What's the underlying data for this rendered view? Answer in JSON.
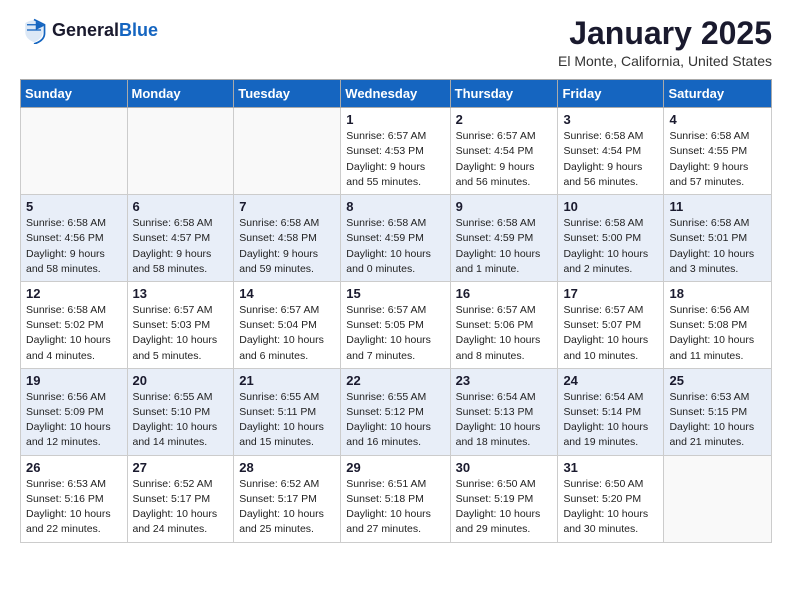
{
  "header": {
    "logo_general": "General",
    "logo_blue": "Blue",
    "month": "January 2025",
    "location": "El Monte, California, United States"
  },
  "weekdays": [
    "Sunday",
    "Monday",
    "Tuesday",
    "Wednesday",
    "Thursday",
    "Friday",
    "Saturday"
  ],
  "weeks": [
    [
      {
        "num": "",
        "detail": ""
      },
      {
        "num": "",
        "detail": ""
      },
      {
        "num": "",
        "detail": ""
      },
      {
        "num": "1",
        "detail": "Sunrise: 6:57 AM\nSunset: 4:53 PM\nDaylight: 9 hours\nand 55 minutes."
      },
      {
        "num": "2",
        "detail": "Sunrise: 6:57 AM\nSunset: 4:54 PM\nDaylight: 9 hours\nand 56 minutes."
      },
      {
        "num": "3",
        "detail": "Sunrise: 6:58 AM\nSunset: 4:54 PM\nDaylight: 9 hours\nand 56 minutes."
      },
      {
        "num": "4",
        "detail": "Sunrise: 6:58 AM\nSunset: 4:55 PM\nDaylight: 9 hours\nand 57 minutes."
      }
    ],
    [
      {
        "num": "5",
        "detail": "Sunrise: 6:58 AM\nSunset: 4:56 PM\nDaylight: 9 hours\nand 58 minutes."
      },
      {
        "num": "6",
        "detail": "Sunrise: 6:58 AM\nSunset: 4:57 PM\nDaylight: 9 hours\nand 58 minutes."
      },
      {
        "num": "7",
        "detail": "Sunrise: 6:58 AM\nSunset: 4:58 PM\nDaylight: 9 hours\nand 59 minutes."
      },
      {
        "num": "8",
        "detail": "Sunrise: 6:58 AM\nSunset: 4:59 PM\nDaylight: 10 hours\nand 0 minutes."
      },
      {
        "num": "9",
        "detail": "Sunrise: 6:58 AM\nSunset: 4:59 PM\nDaylight: 10 hours\nand 1 minute."
      },
      {
        "num": "10",
        "detail": "Sunrise: 6:58 AM\nSunset: 5:00 PM\nDaylight: 10 hours\nand 2 minutes."
      },
      {
        "num": "11",
        "detail": "Sunrise: 6:58 AM\nSunset: 5:01 PM\nDaylight: 10 hours\nand 3 minutes."
      }
    ],
    [
      {
        "num": "12",
        "detail": "Sunrise: 6:58 AM\nSunset: 5:02 PM\nDaylight: 10 hours\nand 4 minutes."
      },
      {
        "num": "13",
        "detail": "Sunrise: 6:57 AM\nSunset: 5:03 PM\nDaylight: 10 hours\nand 5 minutes."
      },
      {
        "num": "14",
        "detail": "Sunrise: 6:57 AM\nSunset: 5:04 PM\nDaylight: 10 hours\nand 6 minutes."
      },
      {
        "num": "15",
        "detail": "Sunrise: 6:57 AM\nSunset: 5:05 PM\nDaylight: 10 hours\nand 7 minutes."
      },
      {
        "num": "16",
        "detail": "Sunrise: 6:57 AM\nSunset: 5:06 PM\nDaylight: 10 hours\nand 8 minutes."
      },
      {
        "num": "17",
        "detail": "Sunrise: 6:57 AM\nSunset: 5:07 PM\nDaylight: 10 hours\nand 10 minutes."
      },
      {
        "num": "18",
        "detail": "Sunrise: 6:56 AM\nSunset: 5:08 PM\nDaylight: 10 hours\nand 11 minutes."
      }
    ],
    [
      {
        "num": "19",
        "detail": "Sunrise: 6:56 AM\nSunset: 5:09 PM\nDaylight: 10 hours\nand 12 minutes."
      },
      {
        "num": "20",
        "detail": "Sunrise: 6:55 AM\nSunset: 5:10 PM\nDaylight: 10 hours\nand 14 minutes."
      },
      {
        "num": "21",
        "detail": "Sunrise: 6:55 AM\nSunset: 5:11 PM\nDaylight: 10 hours\nand 15 minutes."
      },
      {
        "num": "22",
        "detail": "Sunrise: 6:55 AM\nSunset: 5:12 PM\nDaylight: 10 hours\nand 16 minutes."
      },
      {
        "num": "23",
        "detail": "Sunrise: 6:54 AM\nSunset: 5:13 PM\nDaylight: 10 hours\nand 18 minutes."
      },
      {
        "num": "24",
        "detail": "Sunrise: 6:54 AM\nSunset: 5:14 PM\nDaylight: 10 hours\nand 19 minutes."
      },
      {
        "num": "25",
        "detail": "Sunrise: 6:53 AM\nSunset: 5:15 PM\nDaylight: 10 hours\nand 21 minutes."
      }
    ],
    [
      {
        "num": "26",
        "detail": "Sunrise: 6:53 AM\nSunset: 5:16 PM\nDaylight: 10 hours\nand 22 minutes."
      },
      {
        "num": "27",
        "detail": "Sunrise: 6:52 AM\nSunset: 5:17 PM\nDaylight: 10 hours\nand 24 minutes."
      },
      {
        "num": "28",
        "detail": "Sunrise: 6:52 AM\nSunset: 5:17 PM\nDaylight: 10 hours\nand 25 minutes."
      },
      {
        "num": "29",
        "detail": "Sunrise: 6:51 AM\nSunset: 5:18 PM\nDaylight: 10 hours\nand 27 minutes."
      },
      {
        "num": "30",
        "detail": "Sunrise: 6:50 AM\nSunset: 5:19 PM\nDaylight: 10 hours\nand 29 minutes."
      },
      {
        "num": "31",
        "detail": "Sunrise: 6:50 AM\nSunset: 5:20 PM\nDaylight: 10 hours\nand 30 minutes."
      },
      {
        "num": "",
        "detail": ""
      }
    ]
  ]
}
